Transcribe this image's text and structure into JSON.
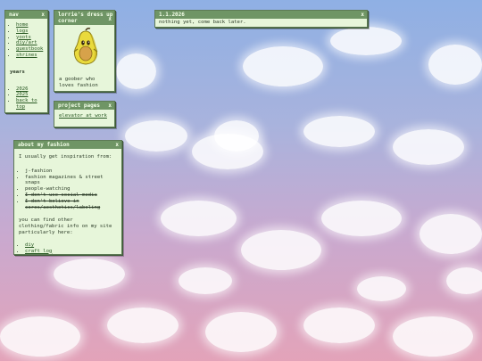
{
  "nav": {
    "title": "nav",
    "close": "x",
    "links": [
      "home",
      "logs",
      "yoots",
      "diy/art",
      "guestbook",
      "shrines"
    ],
    "years_heading": "years",
    "years": [
      "2026",
      "2025",
      "back to top"
    ]
  },
  "dress": {
    "title_line1": "lorrie's dress up",
    "title_line2": "corner",
    "close": "x",
    "caption": "a goober who loves fashion",
    "image_icon": "pear-character-icon"
  },
  "log": {
    "title": "1.1.2026",
    "close": "x",
    "text": "nothing yet, come back later."
  },
  "projects": {
    "title": "project pages",
    "close": "x",
    "link": "elevator at work"
  },
  "fashion": {
    "title": "about my fashion",
    "close": "x",
    "intro": "I usually get inspiration from:",
    "sources": [
      "j-fashion",
      "fashion magazines & street snaps",
      "people-watching"
    ],
    "struck": [
      "I don't use social media",
      "I don't believe in cores/aesthetics/labeling"
    ],
    "other_text": "you can find other clothing/fabric info on my site particularly here:",
    "links": [
      "diy",
      "craft log"
    ]
  },
  "colors": {
    "titlebar": "#6f9565",
    "window_bg": "#e7f6da",
    "sky_top": "#8fb0e4",
    "sky_bottom": "#e3a3b9"
  }
}
